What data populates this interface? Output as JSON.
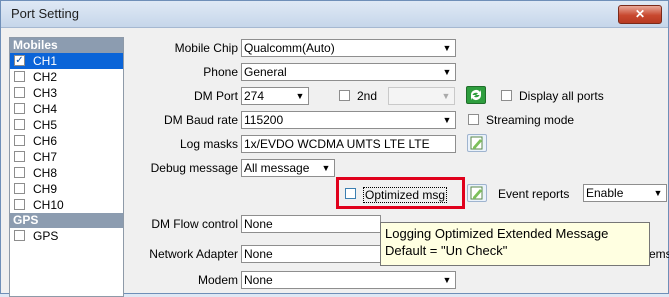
{
  "window": {
    "title": "Port Setting",
    "close_label": "✕"
  },
  "sidebar": {
    "groups": [
      {
        "label": "Mobiles",
        "items": [
          {
            "label": "CH1",
            "checked": true,
            "selected": true
          },
          {
            "label": "CH2",
            "checked": false
          },
          {
            "label": "CH3",
            "checked": false
          },
          {
            "label": "CH4",
            "checked": false
          },
          {
            "label": "CH5",
            "checked": false
          },
          {
            "label": "CH6",
            "checked": false
          },
          {
            "label": "CH7",
            "checked": false
          },
          {
            "label": "CH8",
            "checked": false
          },
          {
            "label": "CH9",
            "checked": false
          },
          {
            "label": "CH10",
            "checked": false
          }
        ]
      },
      {
        "label": "GPS",
        "items": [
          {
            "label": "GPS",
            "checked": false
          }
        ]
      }
    ]
  },
  "form": {
    "mobile_chip": {
      "label": "Mobile Chip",
      "value": "Qualcomm(Auto)"
    },
    "phone": {
      "label": "Phone",
      "value": "General"
    },
    "dm_port": {
      "label": "DM Port",
      "value": "274",
      "second_label": "2nd",
      "second_value": ""
    },
    "display_all_ports": {
      "label": "Display all ports",
      "checked": false
    },
    "dm_baud_rate": {
      "label": "DM Baud rate",
      "value": "115200"
    },
    "streaming_mode": {
      "label": "Streaming mode",
      "checked": false
    },
    "log_masks": {
      "label": "Log masks",
      "value": "1x/EVDO WCDMA UMTS LTE LTE"
    },
    "debug_message": {
      "label": "Debug message",
      "value": "All message"
    },
    "optimized_msg": {
      "label": "Optimized msg",
      "checked": false
    },
    "event_reports": {
      "label": "Event reports",
      "value": "Enable"
    },
    "dm_flow_control": {
      "label": "DM Flow control",
      "value": "None"
    },
    "network_adapter": {
      "label": "Network Adapter",
      "value": "None",
      "suffix": "ems"
    },
    "modem": {
      "label": "Modem",
      "value": "None"
    }
  },
  "tooltip": {
    "line1": "Logging Optimized Extended Message",
    "line2": "Default = \"Un Check\""
  },
  "colors": {
    "highlight_box": "#e0001b",
    "selection": "#0a64d8",
    "tooltip_bg": "#ffffe1"
  },
  "icons": {
    "refresh": "refresh-icon",
    "edit": "edit-icon"
  }
}
